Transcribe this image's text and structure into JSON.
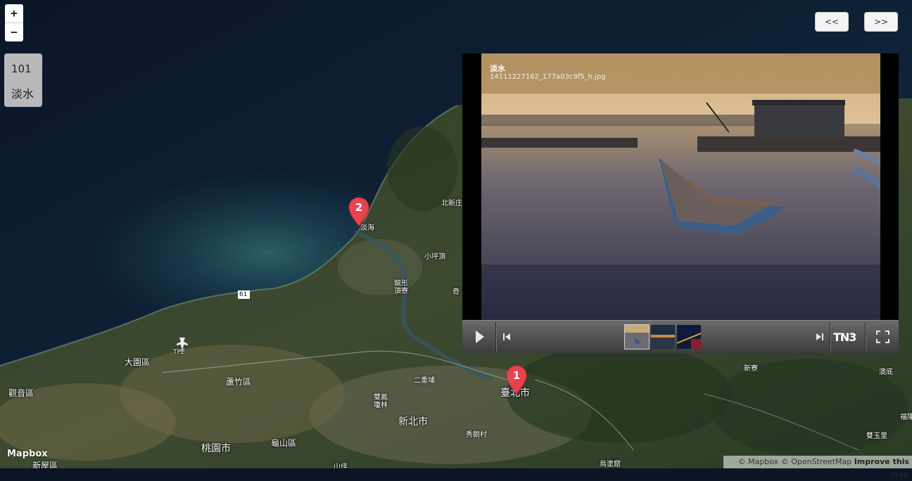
{
  "map": {
    "place_labels": [
      {
        "id": "tamsui-map",
        "text": "淡海"
      },
      {
        "id": "beizhuang",
        "text": "北新庄"
      },
      {
        "id": "xiaopingding",
        "text": "小坪頂"
      },
      {
        "id": "longxing",
        "text": "龍形\n頂寮"
      },
      {
        "id": "qi",
        "text": "奇"
      },
      {
        "id": "dayuan",
        "text": "大園區"
      },
      {
        "id": "guanyin",
        "text": "觀音區"
      },
      {
        "id": "luzhu",
        "text": "蘆竹區"
      },
      {
        "id": "taoyuan",
        "text": "桃園市"
      },
      {
        "id": "xinwu",
        "text": "新屋區"
      },
      {
        "id": "guishan",
        "text": "龜山區"
      },
      {
        "id": "newtaipei",
        "text": "新北市"
      },
      {
        "id": "taipei",
        "text": "臺北市"
      },
      {
        "id": "erchongpu",
        "text": "二重埔"
      },
      {
        "id": "shuangfeng",
        "text": "雙鳳\n瓊林"
      },
      {
        "id": "xiuping",
        "text": "秀朗村"
      },
      {
        "id": "xinliao",
        "text": "新寮"
      },
      {
        "id": "aodi",
        "text": "澳底"
      },
      {
        "id": "shuangyuli",
        "text": "雙玉里"
      },
      {
        "id": "fulong",
        "text": "福隆"
      },
      {
        "id": "wulai",
        "text": "烏塗窟"
      },
      {
        "id": "shanjiao",
        "text": "山佳"
      },
      {
        "id": "tpe",
        "text": "TPE"
      },
      {
        "id": "route61",
        "text": "61"
      }
    ]
  },
  "zoom": {
    "in": "+",
    "out": "−"
  },
  "info": {
    "number": "101",
    "name": "淡水"
  },
  "nav": {
    "prev": "<<",
    "next": ">>"
  },
  "markers": [
    {
      "label": "2"
    },
    {
      "label": "1"
    }
  ],
  "gallery": {
    "title": "淡水",
    "filename": "14111227162_177a03c9f5_h.jpg",
    "brand": "TN3",
    "thumbnails": [
      {
        "name": "thumb-boat-harbor",
        "active": true
      },
      {
        "name": "thumb-sunset-river",
        "active": false
      },
      {
        "name": "thumb-night-bridge",
        "active": false
      }
    ]
  },
  "attribution": {
    "logo": "Mapbox",
    "copy_mapbox": "© Mapbox",
    "copy_osm": "© OpenStreetMap",
    "improve": "Improve this map"
  },
  "colors": {
    "marker": "#e8434f",
    "infobox": "#b9b9bb",
    "caption": "#b08e5f"
  }
}
